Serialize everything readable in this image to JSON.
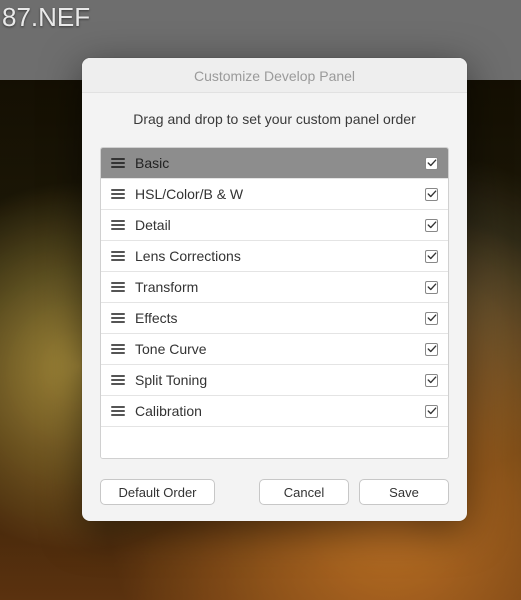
{
  "filename": "87.NEF",
  "dialog": {
    "title": "Customize Develop Panel",
    "instruction": "Drag and drop to set your custom panel order",
    "buttons": {
      "default_order": "Default Order",
      "cancel": "Cancel",
      "save": "Save"
    }
  },
  "panels": [
    {
      "label": "Basic",
      "checked": true,
      "selected": true
    },
    {
      "label": "HSL/Color/B & W",
      "checked": true,
      "selected": false
    },
    {
      "label": "Detail",
      "checked": true,
      "selected": false
    },
    {
      "label": "Lens Corrections",
      "checked": true,
      "selected": false
    },
    {
      "label": "Transform",
      "checked": true,
      "selected": false
    },
    {
      "label": "Effects",
      "checked": true,
      "selected": false
    },
    {
      "label": "Tone Curve",
      "checked": true,
      "selected": false
    },
    {
      "label": "Split Toning",
      "checked": true,
      "selected": false
    },
    {
      "label": "Calibration",
      "checked": true,
      "selected": false
    }
  ]
}
